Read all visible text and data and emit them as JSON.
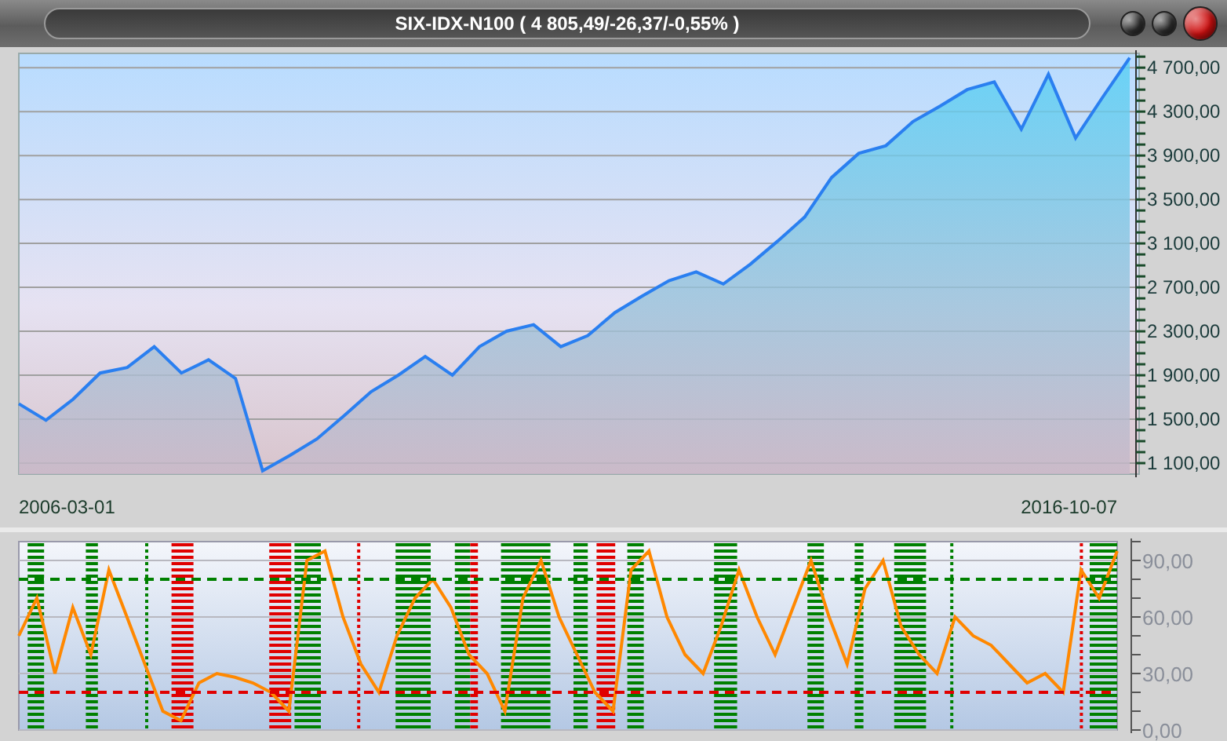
{
  "window": {
    "title": "SIX-IDX-N100 ( 4 805,49/-26,37/-0,55% )",
    "buttons": [
      {
        "color": "#333333"
      },
      {
        "color": "#333333"
      },
      {
        "color": "#d01010"
      }
    ]
  },
  "price_chart": {
    "chart_data": {
      "type": "area",
      "ylim": [
        1000,
        4830
      ],
      "grid": true,
      "series": [
        {
          "color": "#2a7ff0",
          "values": [
            1640,
            1490,
            1680,
            1920,
            1970,
            2160,
            1920,
            2040,
            1870,
            1030,
            1170,
            1320,
            1530,
            1750,
            1900,
            2070,
            1900,
            2160,
            2300,
            2360,
            2160,
            2260,
            2470,
            2620,
            2760,
            2840,
            2730,
            2910,
            3120,
            3340,
            3700,
            3920,
            3990,
            4210,
            4350,
            4500,
            4570,
            4140,
            4640,
            4060,
            4430,
            4790
          ]
        }
      ],
      "yticks": [
        {
          "value": 1100,
          "label": "1 100,00"
        },
        {
          "value": 1500,
          "label": "1 500,00"
        },
        {
          "value": 1900,
          "label": "1 900,00"
        },
        {
          "value": 2300,
          "label": "2 300,00"
        },
        {
          "value": 2700,
          "label": "2 700,00"
        },
        {
          "value": 3100,
          "label": "3 100,00"
        },
        {
          "value": 3500,
          "label": "3 500,00"
        },
        {
          "value": 3900,
          "label": "3 900,00"
        },
        {
          "value": 4300,
          "label": "4 300,00"
        },
        {
          "value": 4700,
          "label": "4 700,00"
        }
      ]
    },
    "dates": [
      "2006-03-01",
      "2016-10-07"
    ]
  },
  "oscillator": {
    "chart_data": {
      "type": "line",
      "ylim": [
        0,
        100
      ],
      "grid": true,
      "series": [
        {
          "color": "#ff8800",
          "values": [
            50,
            70,
            30,
            65,
            40,
            85,
            60,
            35,
            10,
            5,
            25,
            30,
            28,
            25,
            20,
            10,
            90,
            95,
            60,
            35,
            20,
            50,
            70,
            80,
            65,
            40,
            30,
            10,
            70,
            90,
            60,
            40,
            20,
            10,
            85,
            95,
            60,
            40,
            30,
            55,
            85,
            60,
            40,
            65,
            90,
            60,
            35,
            75,
            90,
            55,
            40,
            30,
            60,
            50,
            45,
            35,
            25,
            30,
            20,
            85,
            70,
            95
          ]
        }
      ],
      "yticks": [
        {
          "value": 0,
          "label": "0,00"
        },
        {
          "value": 30,
          "label": "30,00"
        },
        {
          "value": 60,
          "label": "60,00"
        },
        {
          "value": 90,
          "label": "90,00"
        }
      ],
      "ref_lines": [
        {
          "axis": "y",
          "value": 80,
          "color": "#008000"
        },
        {
          "axis": "y",
          "value": 20,
          "color": "#e00000"
        }
      ]
    }
  }
}
